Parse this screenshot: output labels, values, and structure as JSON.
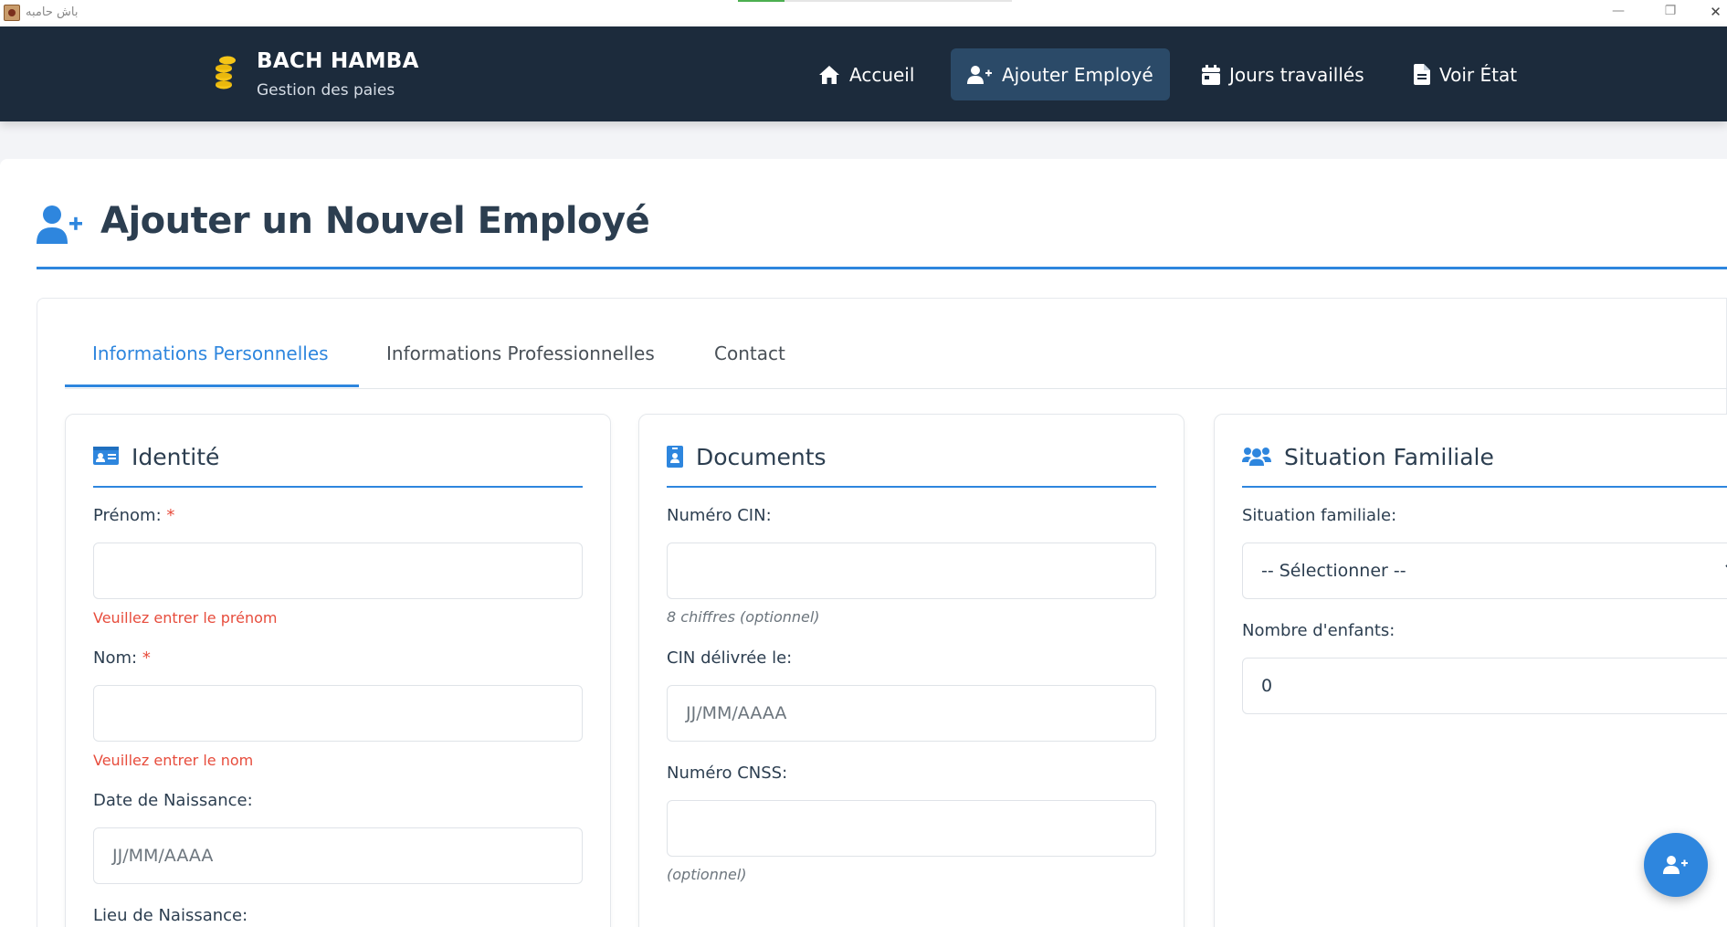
{
  "window": {
    "title": "باش حامبه",
    "minimize": "—",
    "maximize": "❐",
    "close": "✕",
    "progress": 0.17
  },
  "brand": {
    "name": "BACH HAMBA",
    "subtitle": "Gestion des paies"
  },
  "nav": [
    {
      "label": "Accueil",
      "icon": "home-icon"
    },
    {
      "label": "Ajouter Employé",
      "icon": "user-plus-icon",
      "active": true
    },
    {
      "label": "Jours travaillés",
      "icon": "calendar-icon"
    },
    {
      "label": "Voir État",
      "icon": "file-icon"
    }
  ],
  "page": {
    "title": "Ajouter un Nouvel Employé",
    "icon": "user-plus-icon"
  },
  "tabs": [
    {
      "label": "Informations Personnelles",
      "active": true
    },
    {
      "label": "Informations Professionnelles"
    },
    {
      "label": "Contact"
    }
  ],
  "identite": {
    "title": "Identité",
    "prenom_label": "Prénom:",
    "prenom_value": "",
    "prenom_error": "Veuillez entrer le prénom",
    "nom_label": "Nom:",
    "nom_value": "",
    "nom_error": "Veuillez entrer le nom",
    "naissance_label": "Date de Naissance:",
    "naissance_placeholder": "JJ/MM/AAAA",
    "lieu_label": "Lieu de Naissance:",
    "required_mark": "*"
  },
  "documents": {
    "title": "Documents",
    "cin_label": "Numéro CIN:",
    "cin_value": "",
    "cin_hint": "8 chiffres (optionnel)",
    "cin_date_label": "CIN délivrée le:",
    "cin_date_placeholder": "JJ/MM/AAAA",
    "cnss_label": "Numéro CNSS:",
    "cnss_value": "",
    "cnss_hint": "(optionnel)"
  },
  "famille": {
    "title": "Situation Familiale",
    "situation_label": "Situation familiale:",
    "situation_value": "-- Sélectionner --",
    "enfants_label": "Nombre d'enfants:",
    "enfants_value": "0"
  },
  "colors": {
    "navbar": "#1c2b3c",
    "accent": "#2e86de",
    "error": "#e74c3c",
    "brand_coin": "#f5c518"
  }
}
